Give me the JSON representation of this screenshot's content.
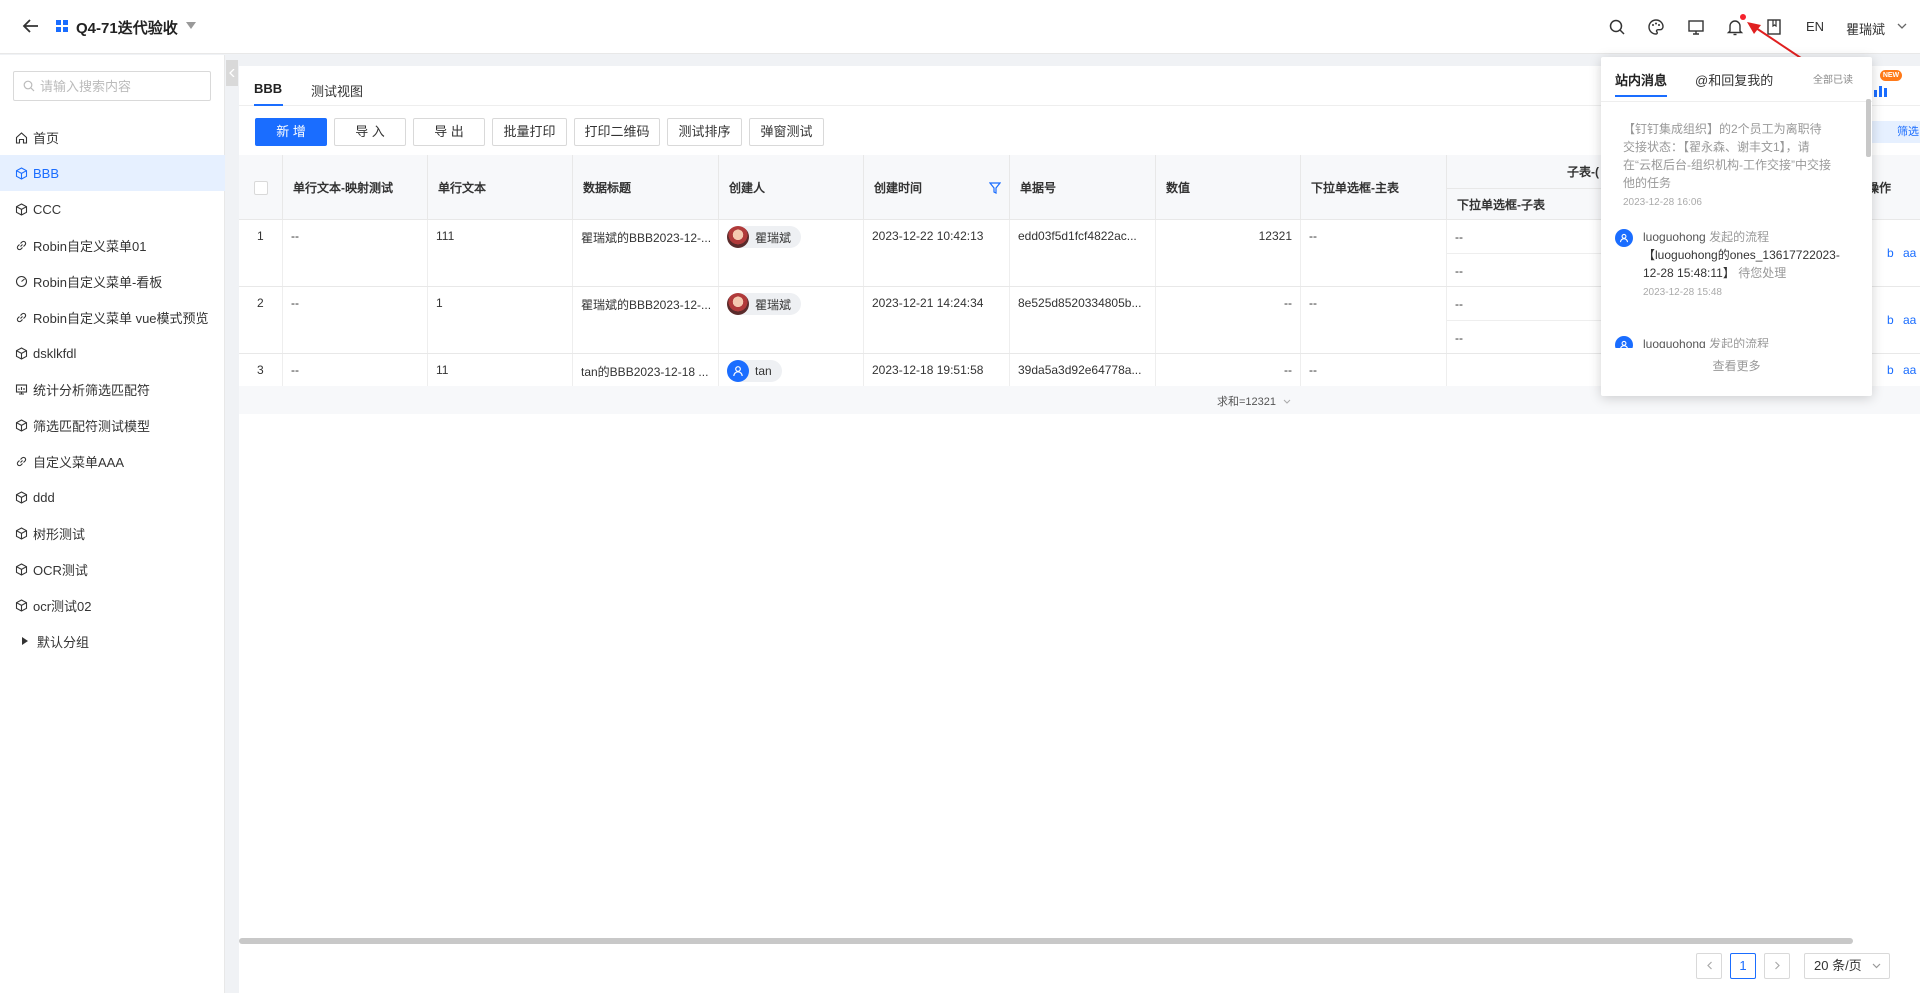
{
  "header": {
    "app_title": "Q4-71迭代验收",
    "lang": "EN",
    "user_name": "瞿瑞斌"
  },
  "sidebar": {
    "search_placeholder": "请输入搜索内容",
    "items": [
      {
        "label": "首页",
        "icon": "home-icon"
      },
      {
        "label": "BBB",
        "icon": "cube-icon",
        "active": true
      },
      {
        "label": "CCC",
        "icon": "cube-icon"
      },
      {
        "label": "Robin自定义菜单01",
        "icon": "link-icon"
      },
      {
        "label": "Robin自定义菜单-看板",
        "icon": "dashboard-icon"
      },
      {
        "label": "Robin自定义菜单 vue模式预览",
        "icon": "link-icon"
      },
      {
        "label": "dsklkfdl",
        "icon": "cube-icon"
      },
      {
        "label": "统计分析筛选匹配符",
        "icon": "report-icon"
      },
      {
        "label": "筛选匹配符测试模型",
        "icon": "cube-icon"
      },
      {
        "label": "自定义菜单AAA",
        "icon": "link-icon"
      },
      {
        "label": "ddd",
        "icon": "cube-icon"
      },
      {
        "label": "树形测试",
        "icon": "cube-icon"
      },
      {
        "label": "OCR测试",
        "icon": "cube-icon"
      },
      {
        "label": "ocr测试02",
        "icon": "cube-icon"
      }
    ],
    "group_label": "默认分组"
  },
  "main": {
    "tabs": [
      "BBB",
      "测试视图"
    ],
    "toolbar": [
      "新 增",
      "导 入",
      "导 出",
      "批量打印",
      "打印二维码",
      "测试排序",
      "弹窗测试"
    ],
    "filter_label": "筛选"
  },
  "table": {
    "headers": [
      "单行文本-映射测试",
      "单行文本",
      "数据标题",
      "创建人",
      "创建时间",
      "单据号",
      "数值",
      "下拉单选框-主表"
    ],
    "group_header": "子表-(",
    "sub_header": "下拉单选框-子表",
    "action_header": "操作",
    "rows": [
      {
        "index": "1",
        "map_text": "--",
        "text": "111",
        "title": "瞿瑞斌的BBB2023-12-...",
        "creator": "瞿瑞斌",
        "created": "2023-12-22 10:42:13",
        "doc_no": "edd03f5d1fcf4822ac...",
        "value": "12321",
        "dropdown": "--",
        "sub": [
          "--",
          "--"
        ],
        "ops": [
          "b",
          "aa"
        ]
      },
      {
        "index": "2",
        "map_text": "--",
        "text": "1",
        "title": "瞿瑞斌的BBB2023-12-...",
        "creator": "瞿瑞斌",
        "created": "2023-12-21 14:24:34",
        "doc_no": "8e525d8520334805b...",
        "value": "--",
        "dropdown": "--",
        "sub": [
          "--",
          "--"
        ],
        "ops": [
          "b",
          "aa"
        ]
      },
      {
        "index": "3",
        "map_text": "--",
        "text": "11",
        "title": "tan的BBB2023-12-18 ...",
        "creator": "tan",
        "created": "2023-12-18 19:51:58",
        "doc_no": "39da5a3d92e64778a...",
        "value": "--",
        "dropdown": "--",
        "sub": [],
        "ops": [
          "b",
          "aa"
        ]
      }
    ],
    "summary": "求和=12321"
  },
  "pagination": {
    "current": "1",
    "page_size": "20 条/页"
  },
  "notifications": {
    "tabs": [
      "站内消息",
      "@和回复我的"
    ],
    "read_all": "全部已读",
    "system_message": "【钉钉集成组织】的2个员工为离职待交接状态：【翟永森、谢丰文1】，请在“云枢后台-组织机构-工作交接”中交接他的任务",
    "system_time": "2023-12-28 16:06",
    "flow_message": {
      "user": "luoguohong",
      "action": "发起的流程",
      "body": "【luoguohong的ones_13617722023-12-28 15:48:11】",
      "status": "待您处理",
      "time": "2023-12-28 15:48"
    },
    "flow_message_2": {
      "user": "luoguohong",
      "action": "发起的流程"
    },
    "more": "查看更多",
    "new_badge": "NEW"
  }
}
